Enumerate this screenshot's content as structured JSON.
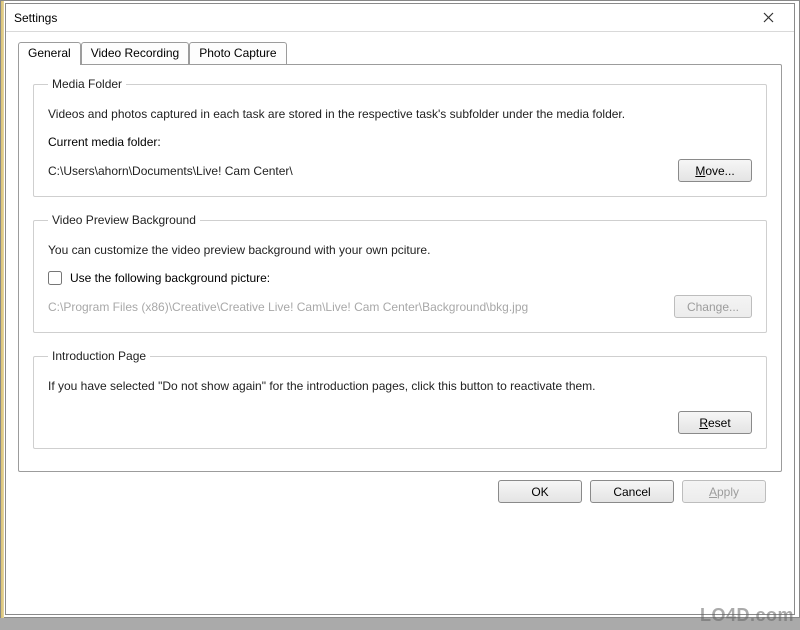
{
  "window": {
    "title": "Settings"
  },
  "tabs": {
    "general": "General",
    "video_recording": "Video Recording",
    "photo_capture": "Photo Capture"
  },
  "media_folder": {
    "legend": "Media Folder",
    "desc": "Videos and photos captured in each task are stored in the respective task's subfolder under the media folder.",
    "current_label": "Current media folder:",
    "path": "C:\\Users\\ahorn\\Documents\\Live! Cam Center\\",
    "move_btn_prefix": "M",
    "move_btn_rest": "ove..."
  },
  "preview_bg": {
    "legend": "Video Preview Background",
    "desc": "You can customize the video preview background with your own pciture.",
    "checkbox_label": "Use the following background picture:",
    "path": "C:\\Program Files (x86)\\Creative\\Creative Live! Cam\\Live! Cam Center\\Background\\bkg.jpg",
    "change_btn": "Change..."
  },
  "intro": {
    "legend": "Introduction Page",
    "desc": "If you have selected \"Do not show again\" for the introduction pages, click this button to reactivate them.",
    "reset_btn_prefix": "R",
    "reset_btn_rest": "eset"
  },
  "buttons": {
    "ok": "OK",
    "cancel": "Cancel",
    "apply_prefix": "A",
    "apply_rest": "pply"
  },
  "watermark": "LO4D.com"
}
